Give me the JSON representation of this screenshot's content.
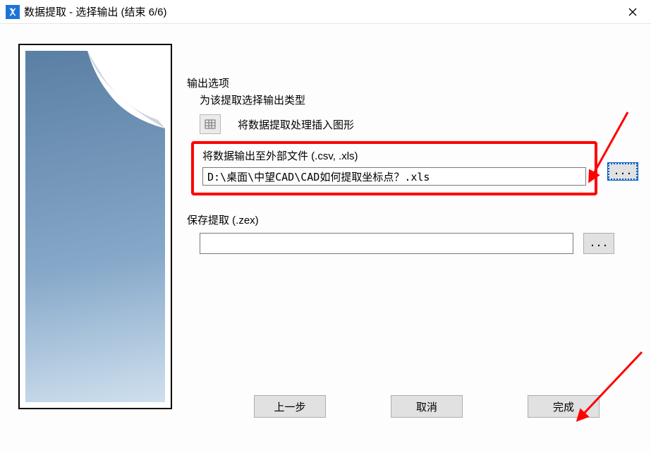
{
  "window": {
    "title": "数据提取 - 选择输出 (结束 6/6)"
  },
  "output_options": {
    "legend": "输出选项",
    "subtitle": "为该提取选择输出类型",
    "insert_drawing_label": "将数据提取处理插入图形",
    "external_file_label": "将数据输出至外部文件 (.csv, .xls)",
    "external_file_path": "D:\\桌面\\中望CAD\\CAD如何提取坐标点？.xls"
  },
  "save_extract": {
    "label": "保存提取 (.zex)",
    "path": ""
  },
  "buttons": {
    "browse": "...",
    "browse2": "...",
    "back": "上一步",
    "cancel": "取消",
    "finish": "完成"
  }
}
